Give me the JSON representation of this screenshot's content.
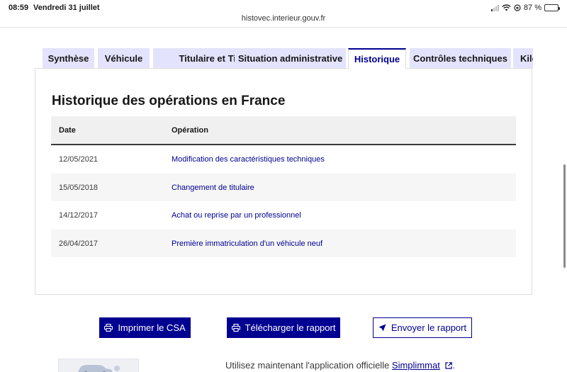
{
  "status_bar": {
    "time": "08:59",
    "date": "Vendredi 31 juillet",
    "battery": "87 %",
    "battery_level": 0.87
  },
  "browser": {
    "url": "histovec.interieur.gouv.fr"
  },
  "tabs": [
    {
      "label": "Synthèse",
      "active": false
    },
    {
      "label": "Véhicule",
      "active": false
    },
    {
      "label": "Titulaire et Titre",
      "active": false
    },
    {
      "label": "Situation administrative",
      "active": false
    },
    {
      "label": "Historique",
      "active": true
    },
    {
      "label": "Contrôles techniques",
      "active": false
    },
    {
      "label": "Kilo",
      "active": false
    }
  ],
  "history": {
    "title": "Historique des opérations en France",
    "columns": [
      "Date",
      "Opération"
    ],
    "rows": [
      {
        "date": "12/05/2021",
        "operation": "Modification des caractéristiques techniques"
      },
      {
        "date": "15/05/2018",
        "operation": "Changement de titulaire"
      },
      {
        "date": "14/12/2017",
        "operation": "Achat ou reprise par un professionnel"
      },
      {
        "date": "26/04/2017",
        "operation": "Première immatriculation d'un véhicule neuf"
      }
    ]
  },
  "actions": {
    "print": "Imprimer le CSA",
    "download": "Télécharger le rapport",
    "send": "Envoyer le rapport"
  },
  "footer": {
    "text": "Utilisez maintenant l'application officielle ",
    "link": "Simplimmat",
    "suffix": "."
  },
  "colors": {
    "primary": "#000091",
    "tab_bg": "#e3e3fd",
    "row_alt": "#f6f6f6"
  }
}
